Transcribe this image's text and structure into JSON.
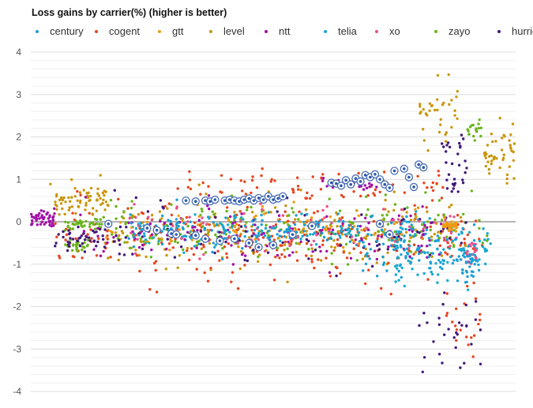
{
  "chart_data": {
    "type": "scatter",
    "title": "Loss gains by carrier(%) (higher is better)",
    "xlabel": "",
    "ylabel": "",
    "ylim": [
      -4,
      4
    ],
    "xlim": [
      0,
      100
    ],
    "yticks": [
      "4",
      "3",
      "2",
      "1",
      "0",
      "-1",
      "-2",
      "-3",
      "-4"
    ],
    "ytick_values": [
      4,
      3,
      2,
      1,
      0,
      -1,
      -2,
      -3,
      -4
    ],
    "minor_grid_step": 0.2,
    "grid": true,
    "legend_position": "top",
    "series": [
      {
        "name": "century",
        "color": "#1a9fd6",
        "clusters": [
          {
            "x0": 20,
            "x1": 75,
            "ymean": -0.2,
            "ysd": 0.2,
            "n": 140
          },
          {
            "x0": 68,
            "x1": 92,
            "ymean": -0.7,
            "ysd": 0.35,
            "n": 90
          },
          {
            "x0": 89,
            "x1": 92,
            "ymean": -1.1,
            "ysd": 0.2,
            "n": 20
          }
        ]
      },
      {
        "name": "cogent",
        "color": "#e8451e",
        "clusters": [
          {
            "x0": 5,
            "x1": 95,
            "ymean": -0.5,
            "ysd": 0.45,
            "n": 260
          },
          {
            "x0": 30,
            "x1": 85,
            "ymean": 0.8,
            "ysd": 0.2,
            "n": 70
          },
          {
            "x0": 85,
            "x1": 93,
            "ymean": -2.4,
            "ysd": 0.4,
            "n": 20
          }
        ]
      },
      {
        "name": "gtt",
        "color": "#f29b12",
        "clusters": [
          {
            "x0": 15,
            "x1": 80,
            "ymean": -0.1,
            "ysd": 0.2,
            "n": 80
          },
          {
            "x0": 85,
            "x1": 88,
            "ymean": -0.1,
            "ysd": 0.06,
            "n": 45
          }
        ]
      },
      {
        "name": "level",
        "color": "#c9960c",
        "clusters": [
          {
            "x0": 4,
            "x1": 16,
            "ymean": 0.5,
            "ysd": 0.2,
            "n": 70
          },
          {
            "x0": 15,
            "x1": 90,
            "ymean": -0.3,
            "ysd": 0.45,
            "n": 200
          },
          {
            "x0": 80,
            "x1": 88,
            "ymean": 2.6,
            "ysd": 0.35,
            "n": 35
          },
          {
            "x0": 93,
            "x1": 100,
            "ymean": 1.6,
            "ysd": 0.3,
            "n": 45
          }
        ]
      },
      {
        "name": "ntt",
        "color": "#a10ea8",
        "clusters": [
          {
            "x0": 0,
            "x1": 5,
            "ymean": 0.05,
            "ysd": 0.1,
            "n": 50
          },
          {
            "x0": 10,
            "x1": 85,
            "ymean": -0.25,
            "ysd": 0.35,
            "n": 140
          },
          {
            "x0": 60,
            "x1": 72,
            "ymean": 0.9,
            "ysd": 0.1,
            "n": 20
          }
        ]
      },
      {
        "name": "telia",
        "color": "#16a9d2",
        "clusters": [
          {
            "x0": 20,
            "x1": 80,
            "ymean": -0.2,
            "ysd": 0.2,
            "n": 100
          },
          {
            "x0": 75,
            "x1": 95,
            "ymean": -0.9,
            "ysd": 0.35,
            "n": 90
          }
        ]
      },
      {
        "name": "xo",
        "color": "#e8508a",
        "clusters": [
          {
            "x0": 20,
            "x1": 88,
            "ymean": -0.2,
            "ysd": 0.3,
            "n": 80
          },
          {
            "x0": 90,
            "x1": 92,
            "ymean": -0.75,
            "ysd": 0.12,
            "n": 20
          }
        ]
      },
      {
        "name": "zayo",
        "color": "#69b51a",
        "clusters": [
          {
            "x0": 7,
            "x1": 12,
            "ymean": -0.55,
            "ysd": 0.06,
            "n": 25
          },
          {
            "x0": 7,
            "x1": 15,
            "ymean": -0.05,
            "ysd": 0.06,
            "n": 40
          },
          {
            "x0": 15,
            "x1": 95,
            "ymean": -0.15,
            "ysd": 0.35,
            "n": 180
          },
          {
            "x0": 90,
            "x1": 93,
            "ymean": 2.2,
            "ysd": 0.12,
            "n": 18
          }
        ]
      },
      {
        "name": "hurricane",
        "color": "#40197a",
        "clusters": [
          {
            "x0": 5,
            "x1": 15,
            "ymean": -0.45,
            "ysd": 0.15,
            "n": 40
          },
          {
            "x0": 15,
            "x1": 90,
            "ymean": -0.3,
            "ysd": 0.35,
            "n": 90
          },
          {
            "x0": 84,
            "x1": 90,
            "ymean": 1.3,
            "ysd": 0.45,
            "n": 30
          },
          {
            "x0": 80,
            "x1": 93,
            "ymean": -2.6,
            "ysd": 0.5,
            "n": 30
          }
        ]
      }
    ],
    "highlighted": {
      "series": "century",
      "points": [
        [
          32,
          0.5
        ],
        [
          34,
          0.48
        ],
        [
          36,
          0.5
        ],
        [
          37,
          0.48
        ],
        [
          38,
          0.52
        ],
        [
          40,
          0.5
        ],
        [
          41,
          0.52
        ],
        [
          42,
          0.5
        ],
        [
          43,
          0.48
        ],
        [
          44,
          0.52
        ],
        [
          45,
          0.55
        ],
        [
          46,
          0.5
        ],
        [
          47,
          0.56
        ],
        [
          48,
          0.52
        ],
        [
          49,
          0.6
        ],
        [
          50,
          0.52
        ],
        [
          51,
          0.55
        ],
        [
          52,
          0.6
        ],
        [
          62,
          0.92
        ],
        [
          63,
          0.9
        ],
        [
          64,
          0.85
        ],
        [
          65,
          0.98
        ],
        [
          66,
          0.88
        ],
        [
          67,
          1.02
        ],
        [
          68,
          0.95
        ],
        [
          69,
          1.1
        ],
        [
          70,
          1.05
        ],
        [
          71,
          1.12
        ],
        [
          72,
          1.0
        ],
        [
          73,
          0.88
        ],
        [
          74,
          0.8
        ],
        [
          75,
          1.2
        ],
        [
          77,
          1.25
        ],
        [
          78,
          1.05
        ],
        [
          80,
          1.35
        ],
        [
          81,
          1.28
        ],
        [
          79,
          0.82
        ],
        [
          24,
          -0.15
        ],
        [
          26,
          -0.2
        ],
        [
          29,
          -0.28
        ],
        [
          30,
          -0.3
        ],
        [
          34,
          -0.32
        ],
        [
          36,
          -0.4
        ],
        [
          39,
          -0.45
        ],
        [
          42,
          -0.4
        ],
        [
          45,
          -0.5
        ],
        [
          47,
          -0.6
        ],
        [
          50,
          -0.55
        ],
        [
          54,
          -0.3
        ],
        [
          58,
          -0.1
        ],
        [
          72,
          -0.05
        ],
        [
          74,
          -0.3
        ],
        [
          16,
          -0.05
        ]
      ]
    }
  }
}
